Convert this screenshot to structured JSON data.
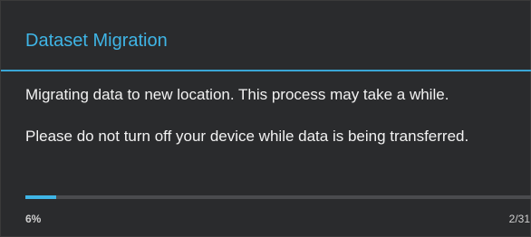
{
  "dialog": {
    "title": "Dataset Migration",
    "message_1": "Migrating data to new location. This process may take a while.",
    "message_2": "Please do not turn off your device while data is being transferred."
  },
  "progress": {
    "fraction": 0.06,
    "percent_label": "6%",
    "count_label": "2/31"
  },
  "colors": {
    "accent": "#3fb5e6",
    "background": "#2a2b2d",
    "track": "#4a4b4e"
  }
}
